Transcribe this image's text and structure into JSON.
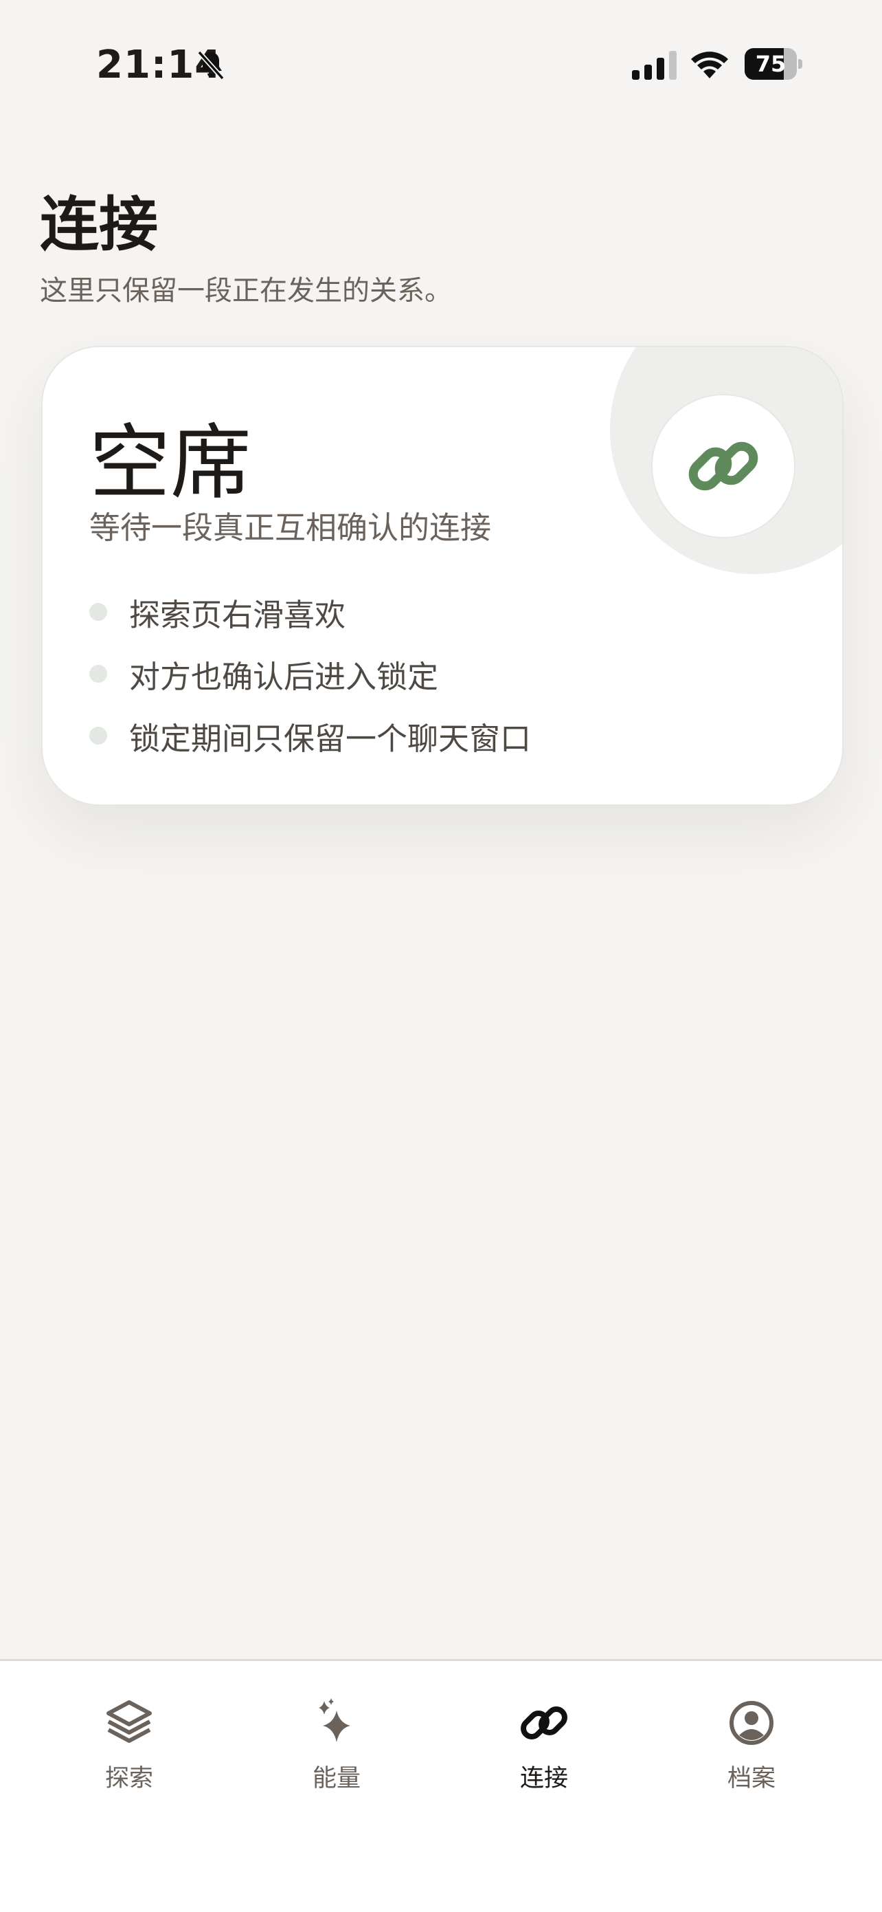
{
  "status_bar": {
    "time": "21:14",
    "battery_level": "75",
    "battery_fraction": 0.75,
    "icons": [
      "bell-slash-icon",
      "signal-icon",
      "wifi-icon",
      "battery-icon"
    ]
  },
  "header": {
    "title": "连接",
    "subtitle": "这里只保留一段正在发生的关系。"
  },
  "card": {
    "title": "空席",
    "subtitle": "等待一段真正互相确认的连接",
    "icon": "link-icon",
    "items": [
      "探索页右滑喜欢",
      "对方也确认后进入锁定",
      "锁定期间只保留一个聊天窗口"
    ]
  },
  "tab_bar": {
    "tabs": [
      {
        "label": "探索",
        "icon": "layers-icon",
        "active": false
      },
      {
        "label": "能量",
        "icon": "sparkle-icon",
        "active": false
      },
      {
        "label": "连接",
        "icon": "link-icon",
        "active": true
      },
      {
        "label": "档案",
        "icon": "profile-icon",
        "active": false
      }
    ]
  },
  "colors": {
    "background": "#f5f4f2",
    "accent_green": "#5f8a5c",
    "text_primary": "#1d1a17",
    "text_secondary": "#6a625b"
  }
}
